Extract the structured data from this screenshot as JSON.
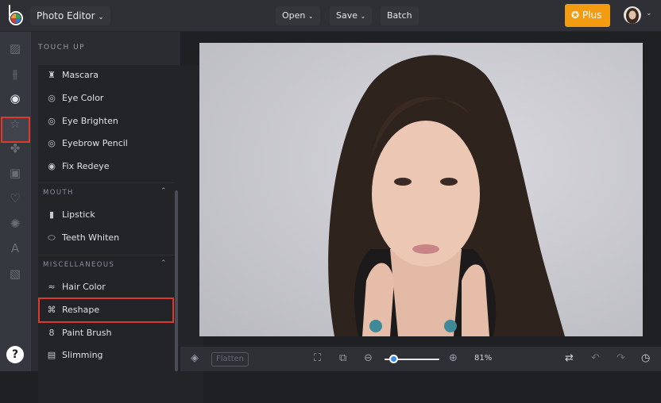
{
  "header": {
    "app_menu": "Photo Editor",
    "open": "Open",
    "save": "Save",
    "batch": "Batch",
    "plus": "Plus"
  },
  "panel": {
    "title": "TOUCH UP",
    "touch_up": [
      "Mascara",
      "Eye Color",
      "Eye Brighten",
      "Eyebrow Pencil",
      "Fix Redeye"
    ],
    "mouth_header": "MOUTH",
    "mouth": [
      "Lipstick",
      "Teeth Whiten"
    ],
    "misc_header": "MISCELLANEOUS",
    "misc": [
      "Hair Color",
      "Reshape",
      "Paint Brush",
      "Slimming"
    ]
  },
  "rail": {
    "help": "?"
  },
  "bottom": {
    "flatten": "Flatten",
    "zoom_level": "81%",
    "zoom_fraction": 0.1
  },
  "colors": {
    "accent": "#f39c12",
    "highlight": "#e0392b",
    "slider": "#3b8ee8"
  }
}
